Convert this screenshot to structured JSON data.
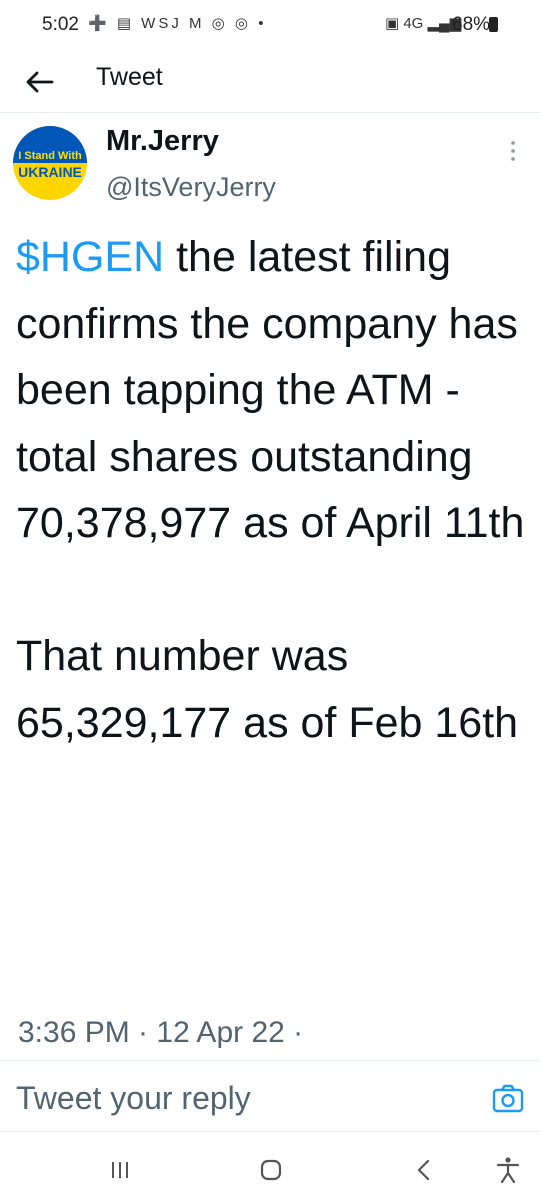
{
  "status_bar": {
    "time": "5:02",
    "left_icons": "➕ ▤ WSJ M ◎ ◎ •",
    "right_icons": "▣ 4G ▂▄▆",
    "battery": "68%"
  },
  "header": {
    "title": "Tweet"
  },
  "author": {
    "avatar_line1": "I Stand With",
    "avatar_line2": "UKRAINE",
    "display_name": "Mr.Jerry",
    "handle": "@ItsVeryJerry"
  },
  "tweet": {
    "cashtag": "$HGEN",
    "body": " the latest filing confirms the company has been tapping the ATM - total shares outstanding 70,378,977 as of April 11th\n\nThat number was 65,329,177 as of Feb 16th",
    "timestamp": "3:36 PM · 12 Apr 22 ·"
  },
  "reply": {
    "placeholder": "Tweet your reply"
  },
  "icons": {
    "back": "arrow-left-icon",
    "more": "more-vertical-icon",
    "camera": "camera-icon",
    "nav": [
      "recent-apps-icon",
      "home-icon",
      "back-icon",
      "accessibility-icon"
    ]
  },
  "colors": {
    "accent": "#1d9bf0",
    "text": "#0f1419",
    "secondary": "#536471"
  }
}
